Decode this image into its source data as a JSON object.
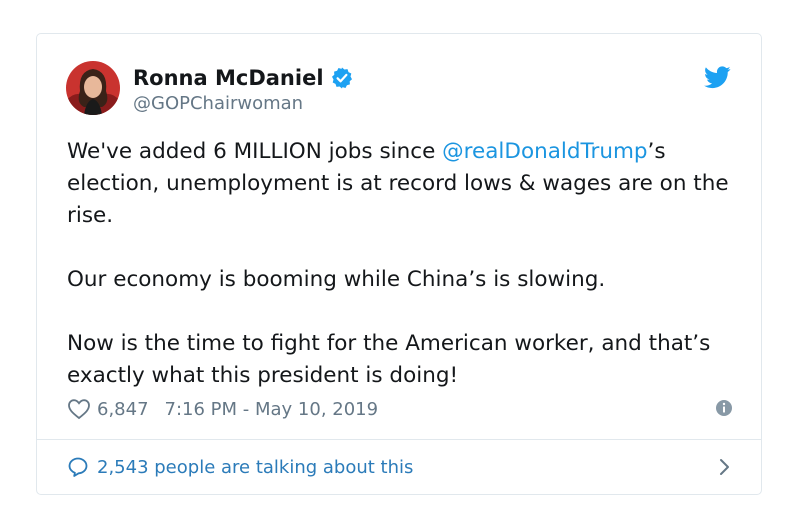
{
  "author": {
    "name": "Ronna McDaniel",
    "handle": "@GOPChairwoman",
    "verified": true
  },
  "tweet": {
    "line1_pre": "We've added 6 MILLION jobs since ",
    "mention": "@realDonaldTrump",
    "line1_post": "’s election, unemployment is at record lows & wages are on the rise.",
    "paragraph2": "Our economy is booming while China’s is slowing.",
    "paragraph3": "Now is the time to fight for the American worker, and that’s exactly what this president is doing!"
  },
  "meta": {
    "likes": "6,847",
    "timestamp": "7:16 PM - May 10, 2019"
  },
  "footer": {
    "talking": "2,543 people are talking about this"
  },
  "icons": {
    "verified": "verified-badge-icon",
    "brand": "twitter-bird-icon",
    "like": "heart-icon",
    "info": "info-icon",
    "reply": "speech-bubble-icon",
    "chevron": "chevron-right-icon"
  },
  "colors": {
    "text": "#14171a",
    "secondary": "#657786",
    "link": "#1b95e0",
    "footer_link": "#2b7bb9",
    "border": "#e1e8ed"
  }
}
